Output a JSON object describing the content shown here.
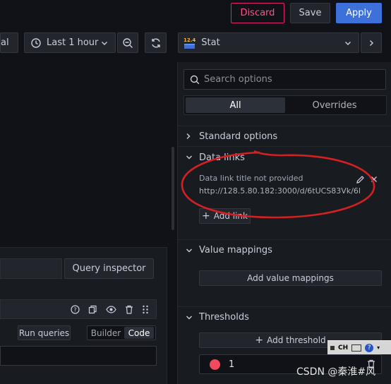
{
  "toolbar": {
    "discard_label": "Discard",
    "save_label": "Save",
    "apply_label": "Apply",
    "left_partial_label": "al",
    "time_range_label": "Last 1 hour"
  },
  "viz_picker": {
    "badge": "12.4",
    "label": "Stat"
  },
  "options": {
    "search_placeholder": "Search options",
    "tab_all": "All",
    "tab_overrides": "Overrides"
  },
  "sections": {
    "standard": "Standard options",
    "data_links": "Data links",
    "value_mappings": "Value mappings",
    "thresholds": "Thresholds"
  },
  "data_link": {
    "title": "Data link title not provided",
    "url": "http://128.5.80.182:3000/d/6tUCS83Vk/6l..."
  },
  "buttons": {
    "add_link": "Add link",
    "add_value_mappings": "Add value mappings",
    "add_threshold": "Add threshold",
    "query_inspector": "Query inspector",
    "run_queries": "Run queries",
    "builder": "Builder",
    "code": "Code"
  },
  "threshold": {
    "value": "1",
    "color": "#f2495c"
  },
  "taskbar": {
    "ime": "CH"
  },
  "watermark": "CSDN @秦淮#风",
  "colors": {
    "accent": "#3d71d9",
    "danger": "#e0226e",
    "annotation": "#d42022"
  }
}
